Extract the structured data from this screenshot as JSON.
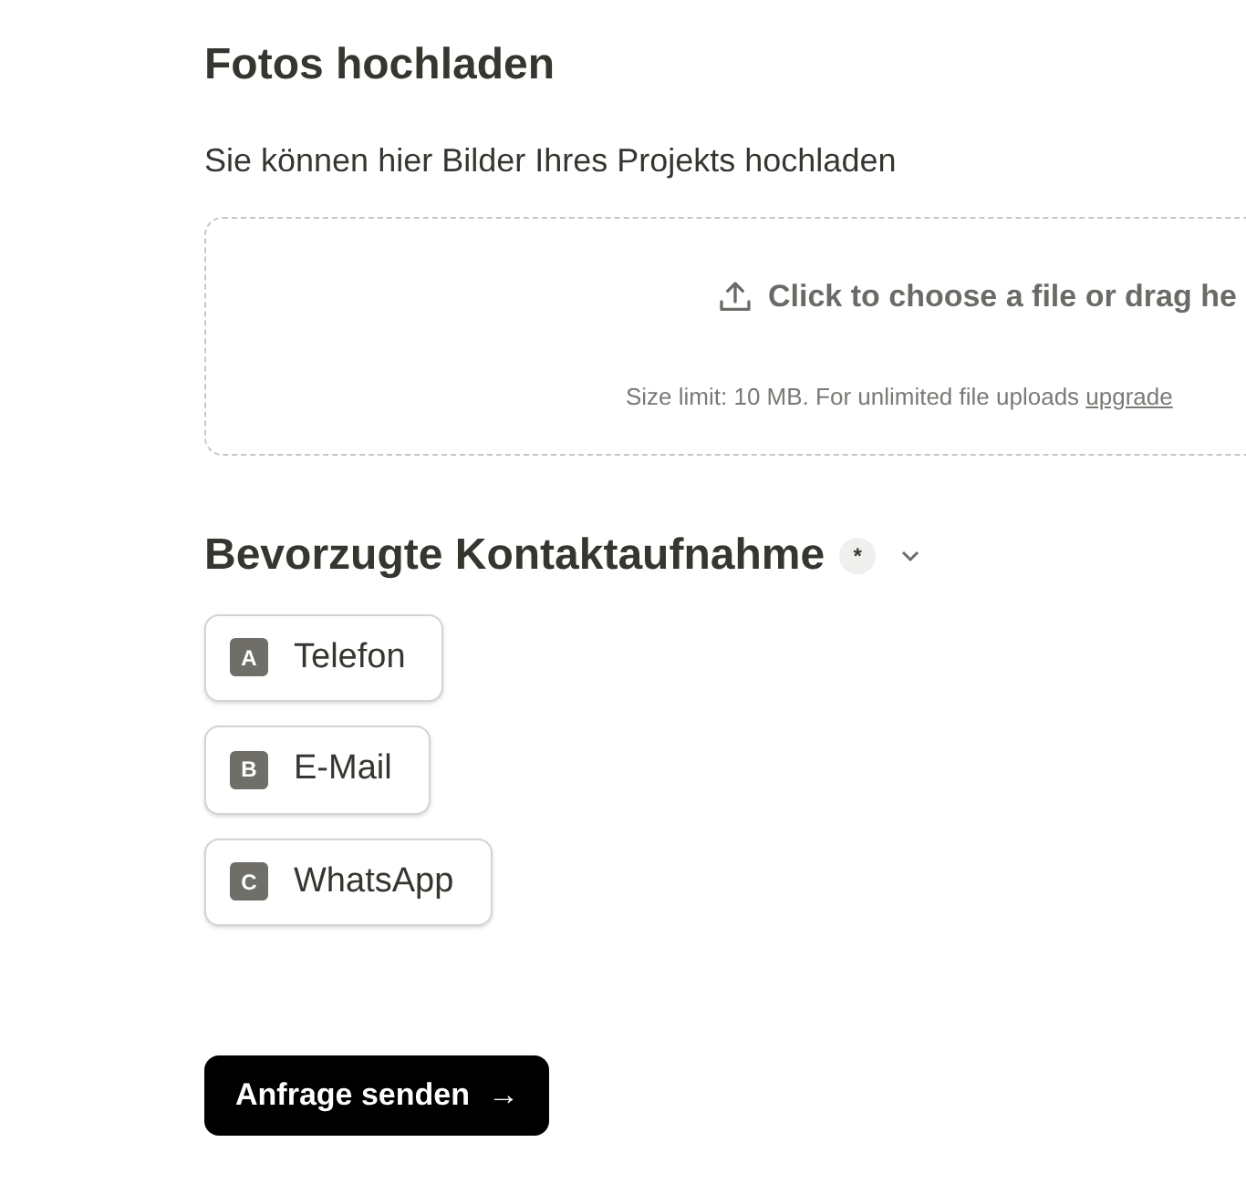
{
  "upload_section": {
    "title": "Fotos hochladen",
    "description": "Sie können hier Bilder Ihres Projekts hochladen",
    "dropzone": {
      "prompt": "Click to choose a file or drag he",
      "note": "Size limit: 10 MB. For unlimited file uploads",
      "link": "upgrade"
    }
  },
  "contact_section": {
    "title": "Bevorzugte Kontaktaufnahme",
    "required_mark": "*",
    "expanded": false,
    "options": [
      {
        "key": "A",
        "label": "Telefon",
        "selected": false
      },
      {
        "key": "B",
        "label": "E-Mail",
        "selected": false
      },
      {
        "key": "C",
        "label": "WhatsApp",
        "selected": false
      }
    ]
  },
  "submit": {
    "label": "Anfrage senden",
    "arrow": "→"
  }
}
